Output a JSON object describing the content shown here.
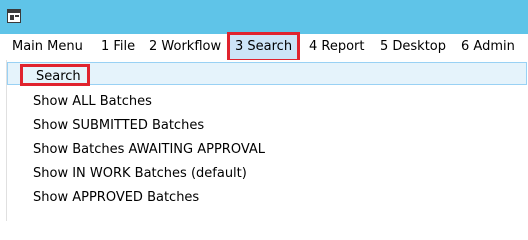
{
  "menubar": {
    "items": [
      {
        "label": "Main Menu"
      },
      {
        "label": "1 File"
      },
      {
        "label": "2 Workflow"
      },
      {
        "label": "3 Search"
      },
      {
        "label": "4 Report"
      },
      {
        "label": "5 Desktop"
      },
      {
        "label": "6 Admin"
      }
    ]
  },
  "dropdown": {
    "items": [
      {
        "label": "Search"
      },
      {
        "label": "Show ALL Batches"
      },
      {
        "label": "Show SUBMITTED Batches"
      },
      {
        "label": "Show Batches AWAITING  APPROVAL"
      },
      {
        "label": "Show IN WORK Batches (default)"
      },
      {
        "label": "Show APPROVED Batches"
      }
    ]
  },
  "colors": {
    "titlebar": "#5fc4e8",
    "selection_fill": "#cce4f7",
    "hover_fill": "#e5f3fb",
    "annotation_red": "#e0232e"
  }
}
